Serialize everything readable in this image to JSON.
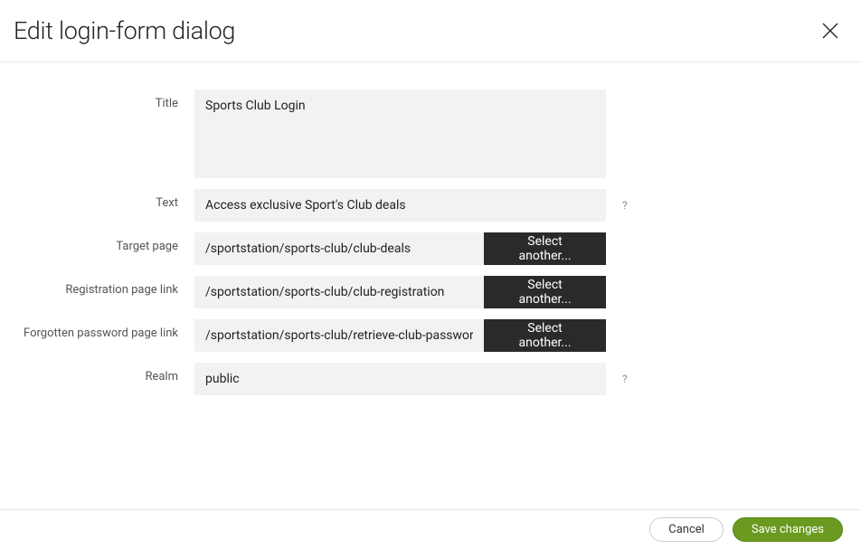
{
  "dialog": {
    "title": "Edit login-form dialog"
  },
  "labels": {
    "title": "Title",
    "text": "Text",
    "targetPage": "Target page",
    "registrationPage": "Registration page link",
    "forgottenPassword": "Forgotten password page link",
    "realm": "Realm"
  },
  "values": {
    "title": "Sports Club Login",
    "text": "Access exclusive Sport's Club deals",
    "targetPage": "/sportstation/sports-club/club-deals",
    "registrationPage": "/sportstation/sports-club/club-registration",
    "forgottenPassword": "/sportstation/sports-club/retrieve-club-password",
    "realm": "public"
  },
  "buttons": {
    "selectAnother": "Select another...",
    "cancel": "Cancel",
    "save": "Save changes"
  },
  "helpChar": "?"
}
